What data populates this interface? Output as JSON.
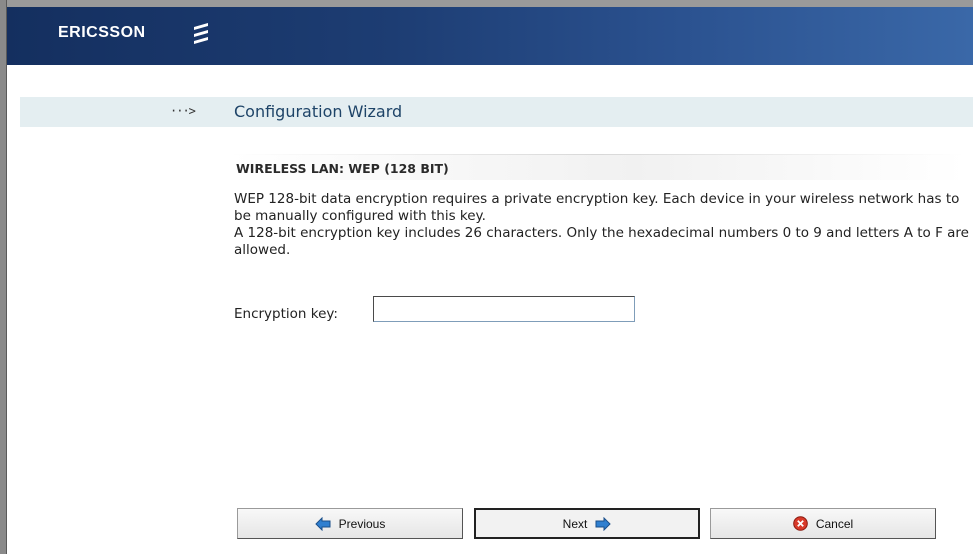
{
  "brand": {
    "name": "ERICSSON",
    "logo_icon": "ericsson-stripes-icon"
  },
  "wizard": {
    "arrow_glyph": "···>",
    "title": "Configuration Wizard"
  },
  "section": {
    "title": "WIRELESS LAN: WEP (128 BIT)"
  },
  "description": {
    "line1": "WEP 128-bit data encryption requires a private encryption key. Each device in your wireless network has to be manually configured with this key.",
    "line2": "A 128-bit encryption key includes 26 characters. Only the hexadecimal numbers 0 to 9 and letters A to F are allowed."
  },
  "form": {
    "encryption_key_label": "Encryption key:",
    "encryption_key_value": ""
  },
  "buttons": {
    "previous": "Previous",
    "next": "Next",
    "cancel": "Cancel"
  },
  "colors": {
    "header_dark": "#142f5f",
    "header_light": "#3a68a8",
    "title_band": "#e4eef1",
    "title_text": "#1e4468",
    "arrow_icon": "#2f7fd0",
    "cancel_icon": "#d83a2a"
  }
}
